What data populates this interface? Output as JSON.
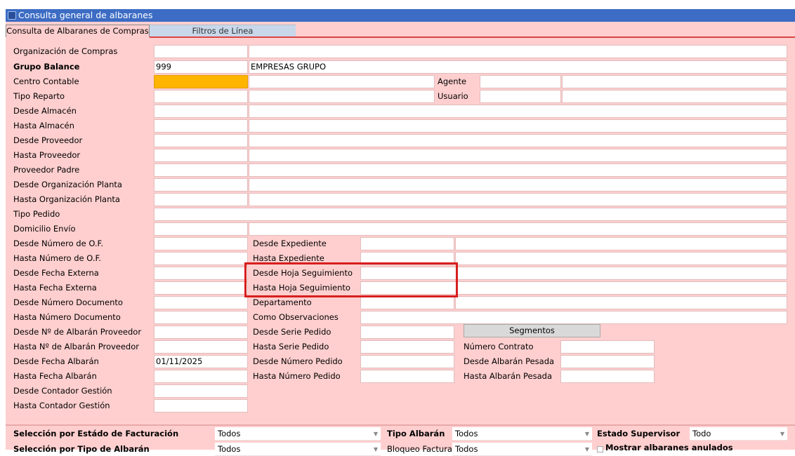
{
  "window": {
    "title": "Consulta general de albaranes"
  },
  "tabs": [
    {
      "label": "Consulta de Albaranes de Compras"
    },
    {
      "label": "Filtros de Línea"
    }
  ],
  "left": {
    "org_compras": {
      "label": "Organización de Compras",
      "code": "",
      "desc": ""
    },
    "grupo_balance": {
      "label": "Grupo Balance",
      "code": "999",
      "desc": "EMPRESAS GRUPO"
    },
    "centro_contable": {
      "label": "Centro Contable",
      "code": "",
      "desc": ""
    },
    "tipo_reparto": {
      "label": "Tipo Reparto",
      "code": "",
      "desc": ""
    },
    "desde_almacen": {
      "label": "Desde Almacén"
    },
    "hasta_almacen": {
      "label": "Hasta Almacén"
    },
    "desde_proveedor": {
      "label": "Desde Proveedor"
    },
    "hasta_proveedor": {
      "label": "Hasta Proveedor"
    },
    "proveedor_padre": {
      "label": "Proveedor Padre"
    },
    "desde_org_planta": {
      "label": "Desde Organización Planta"
    },
    "hasta_org_planta": {
      "label": "Hasta Organización Planta"
    },
    "tipo_pedido": {
      "label": "Tipo Pedido"
    },
    "domicilio_envio": {
      "label": "Domicilio Envío"
    },
    "desde_num_of": {
      "label": "Desde Número de O.F."
    },
    "hasta_num_of": {
      "label": "Hasta Número de O.F."
    },
    "desde_fecha_ext": {
      "label": "Desde Fecha Externa"
    },
    "hasta_fecha_ext": {
      "label": "Hasta Fecha Externa"
    },
    "desde_num_doc": {
      "label": "Desde Número Documento"
    },
    "hasta_num_doc": {
      "label": "Hasta Número Documento"
    },
    "desde_albaran_prov": {
      "label": "Desde Nº de Albarán Proveedor"
    },
    "hasta_albaran_prov": {
      "label": "Hasta Nº de Albarán Proveedor"
    },
    "desde_fecha_alb": {
      "label": "Desde Fecha Albarán",
      "value": "01/11/2025"
    },
    "hasta_fecha_alb": {
      "label": "Hasta Fecha Albarán"
    },
    "desde_contador": {
      "label": "Desde Contador Gestión"
    },
    "hasta_contador": {
      "label": "Hasta Contador Gestión"
    }
  },
  "right": {
    "agente": {
      "label": "Agente"
    },
    "usuario": {
      "label": "Usuario"
    },
    "desde_expediente": {
      "label": "Desde Expediente"
    },
    "hasta_expediente": {
      "label": "Hasta  Expediente"
    },
    "desde_hoja": {
      "label": "Desde Hoja Seguimiento"
    },
    "hasta_hoja": {
      "label": "Hasta Hoja Seguimiento"
    },
    "departamento": {
      "label": "Departamento"
    },
    "como_obs": {
      "label": "Como Observaciones"
    },
    "desde_serie": {
      "label": "Desde Serie Pedido"
    },
    "hasta_serie": {
      "label": "Hasta Serie Pedido"
    },
    "desde_num_pedido": {
      "label": "Desde Número Pedido"
    },
    "hasta_num_pedido": {
      "label": "Hasta Número Pedido"
    },
    "segmentos_button": "Segmentos",
    "num_contrato": {
      "label": "Número Contrato"
    },
    "desde_alb_pesada": {
      "label": "Desde Albarán Pesada"
    },
    "hasta_alb_pesada": {
      "label": "Hasta Albarán Pesada"
    }
  },
  "bottom": {
    "sel_estado_fact": {
      "label": "Selección por Estádo de Facturación",
      "value": "Todos"
    },
    "sel_tipo_albaran": {
      "label": "Selección por Tipo de Albarán",
      "value": "Todos"
    },
    "tipo_albaran": {
      "label": "Tipo Albarán",
      "value": "Todos"
    },
    "bloqueo_factura": {
      "label": "Bloqueo Factura",
      "value": "Todos"
    },
    "estado_supervisor": {
      "label": "Estado Supervisor",
      "value": "Todo"
    },
    "mostrar_anulados": {
      "label": "Mostrar albaranes anulados",
      "checked": false
    }
  },
  "colors": {
    "title_bar": "#3c6cc4",
    "form_bg": "#ffcfcf",
    "focus_field": "#ffb400",
    "highlight_box": "#d81e1e"
  },
  "icons": {
    "app": "app-icon",
    "dropdown": "chevron-down-icon"
  }
}
